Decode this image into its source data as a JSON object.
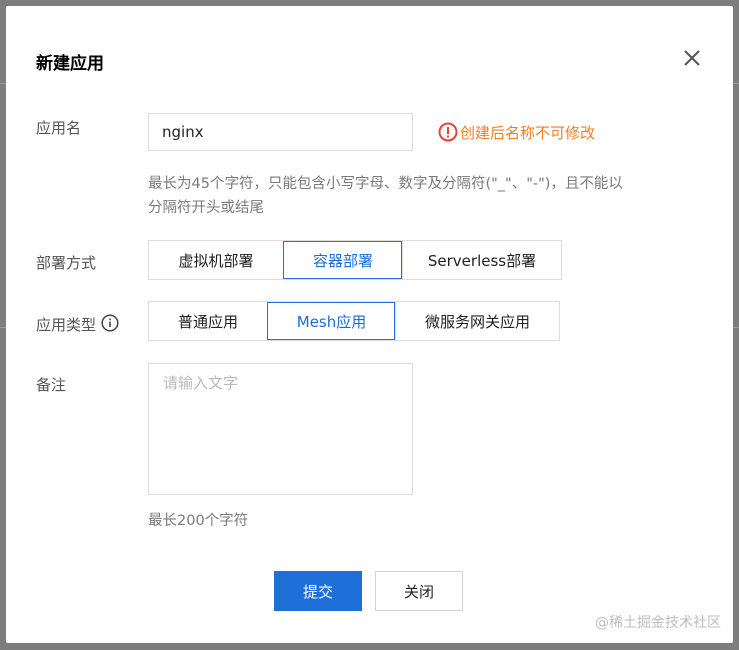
{
  "dialog": {
    "title": "新建应用",
    "close_icon": "close-icon"
  },
  "form": {
    "name": {
      "label": "应用名",
      "value": "nginx",
      "warning": "创建后名称不可修改",
      "warning_icon": "exclamation-circle-icon",
      "help_line1": "最长为45个字符，只能包含小写字母、数字及分隔符(\"_\"、\"-\")，且不能以",
      "help_line2": "分隔符开头或结尾"
    },
    "deploy": {
      "label": "部署方式",
      "options": [
        "虚拟机部署",
        "容器部署",
        "Serverless部署"
      ],
      "selected": "容器部署"
    },
    "app_type": {
      "label": "应用类型",
      "info_icon": "info-circle-icon",
      "options": [
        "普通应用",
        "Mesh应用",
        "微服务网关应用"
      ],
      "selected": "Mesh应用"
    },
    "remark": {
      "label": "备注",
      "placeholder": "请输入文字",
      "limit": "最长200个字符"
    }
  },
  "footer": {
    "submit_label": "提交",
    "close_label": "关闭"
  },
  "watermark": "@稀土掘金技术社区",
  "colors": {
    "accent": "#1f6fd9",
    "warning": "#f07f22",
    "overlay": "#7d7d7d"
  }
}
